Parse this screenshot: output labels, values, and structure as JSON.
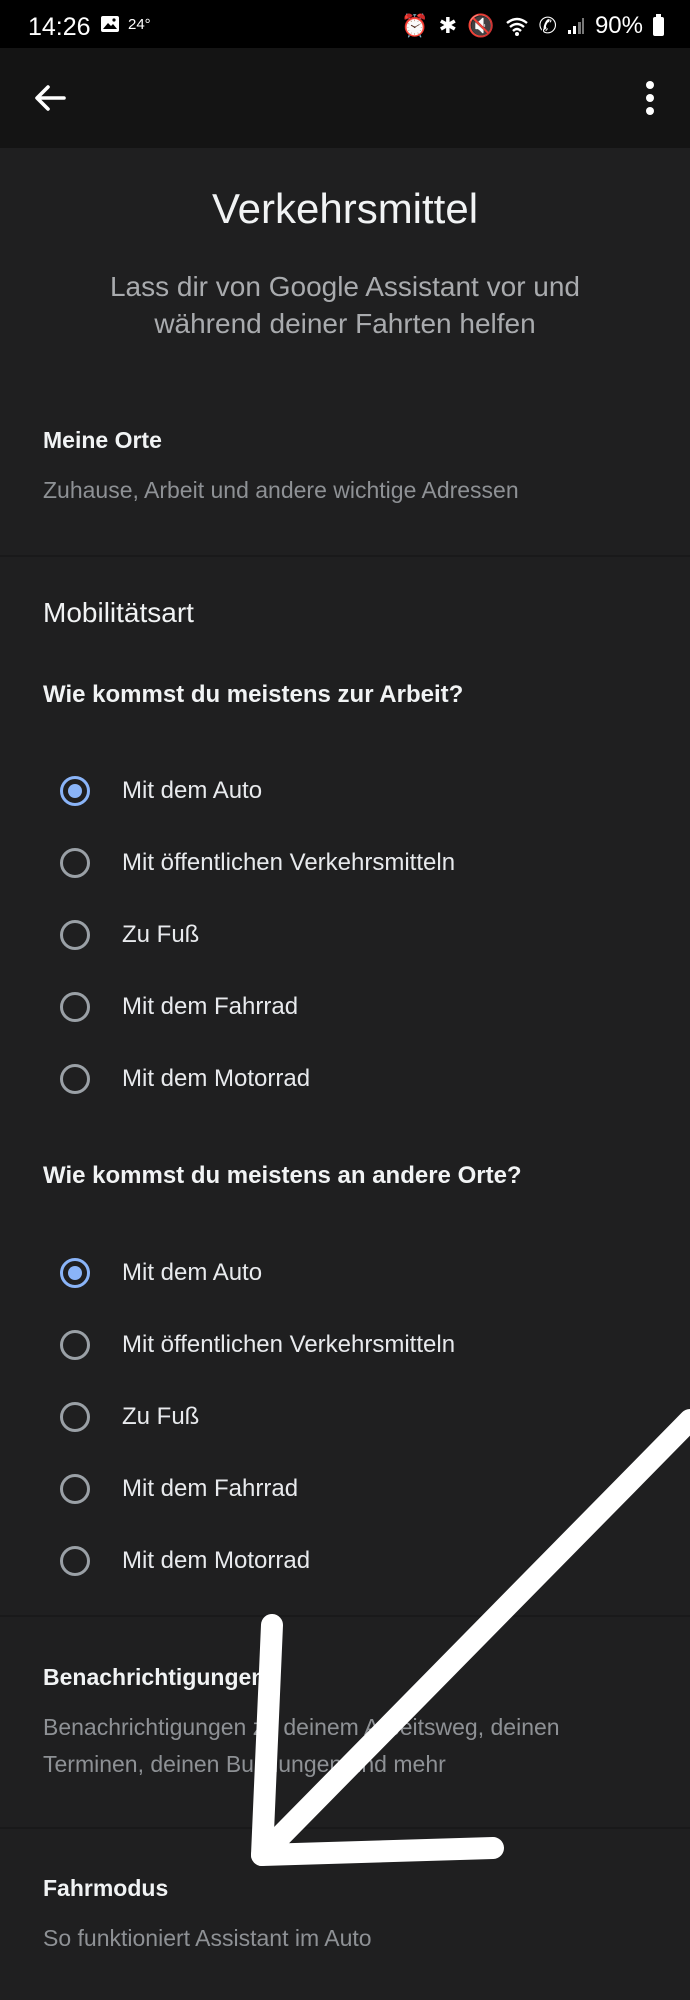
{
  "status_bar": {
    "time": "14:26",
    "temperature": "24°",
    "battery": "90%",
    "icons": [
      "image-icon",
      "alarm-icon",
      "bluetooth-icon",
      "mute-icon",
      "wifi-icon",
      "wifi-call-icon",
      "signal-icon",
      "battery-icon"
    ]
  },
  "app_bar": {
    "back_icon": "arrow-left-icon",
    "more_icon": "more-vertical-icon"
  },
  "header": {
    "title": "Verkehrsmittel",
    "subtitle": "Lass dir von Google Assistant vor und während deiner Fahrten helfen"
  },
  "places": {
    "title": "Meine Orte",
    "description": "Zuhause, Arbeit und andere wichtige Adressen"
  },
  "mobility": {
    "title": "Mobilitätsart",
    "work": {
      "question": "Wie kommst du meistens zur Arbeit?",
      "options": [
        {
          "label": "Mit dem Auto",
          "selected": true
        },
        {
          "label": "Mit öffentlichen Verkehrsmitteln",
          "selected": false
        },
        {
          "label": "Zu Fuß",
          "selected": false
        },
        {
          "label": "Mit dem Fahrrad",
          "selected": false
        },
        {
          "label": "Mit dem Motorrad",
          "selected": false
        }
      ]
    },
    "other": {
      "question": "Wie kommst du meistens an andere Orte?",
      "options": [
        {
          "label": "Mit dem Auto",
          "selected": true
        },
        {
          "label": "Mit öffentlichen Verkehrsmitteln",
          "selected": false
        },
        {
          "label": "Zu Fuß",
          "selected": false
        },
        {
          "label": "Mit dem Fahrrad",
          "selected": false
        },
        {
          "label": "Mit dem Motorrad",
          "selected": false
        }
      ]
    }
  },
  "notifications": {
    "title": "Benachrichtigungen",
    "description": "Benachrichtigungen zu deinem Arbeitsweg, deinen Terminen, deinen Buchungen und mehr"
  },
  "driving_mode": {
    "title": "Fahrmodus",
    "description": "So funktioniert Assistant im Auto"
  },
  "colors": {
    "background": "#1f1f20",
    "accent": "#8ab4f8",
    "annotation_arrow": "#ffffff"
  }
}
